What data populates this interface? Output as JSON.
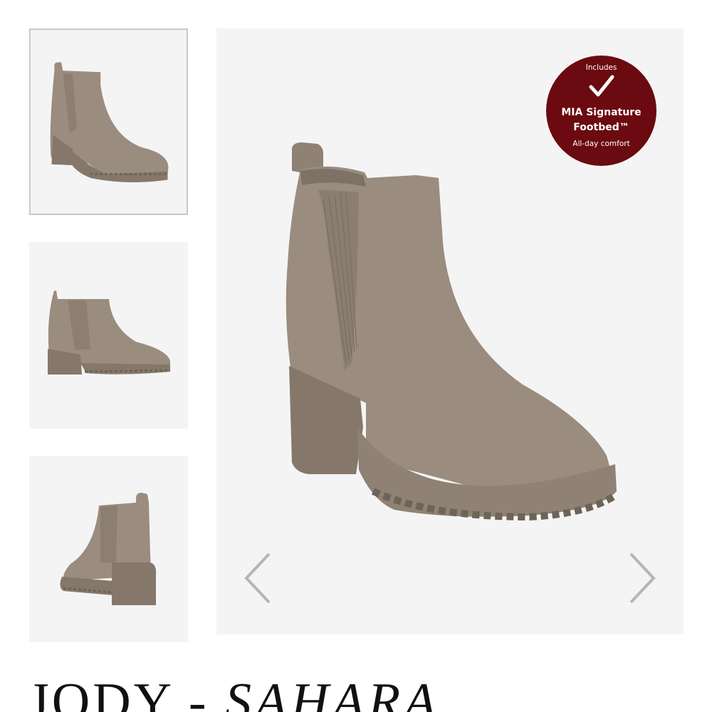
{
  "gallery": {
    "thumbnails": [
      {
        "label": "Boot thumbnail - front three-quarter view",
        "active": true
      },
      {
        "label": "Boot thumbnail - side view",
        "active": false
      },
      {
        "label": "Boot thumbnail - back three-quarter view",
        "active": false
      }
    ],
    "badge": {
      "top_text": "Includes",
      "title_line1": "MIA Signature",
      "title_line2": "Footbed™",
      "subtitle": "All-day comfort",
      "color": "#6b0a10"
    },
    "prev_icon": "chevron-left-icon",
    "next_icon": "chevron-right-icon"
  },
  "product": {
    "name": "JODY",
    "separator": " - ",
    "variant": "SAHARA"
  },
  "colors": {
    "boot": "#9a8c7e",
    "boot_dark": "#7e7165",
    "image_bg": "#f4f4f4",
    "arrow": "#b5b5b5"
  }
}
